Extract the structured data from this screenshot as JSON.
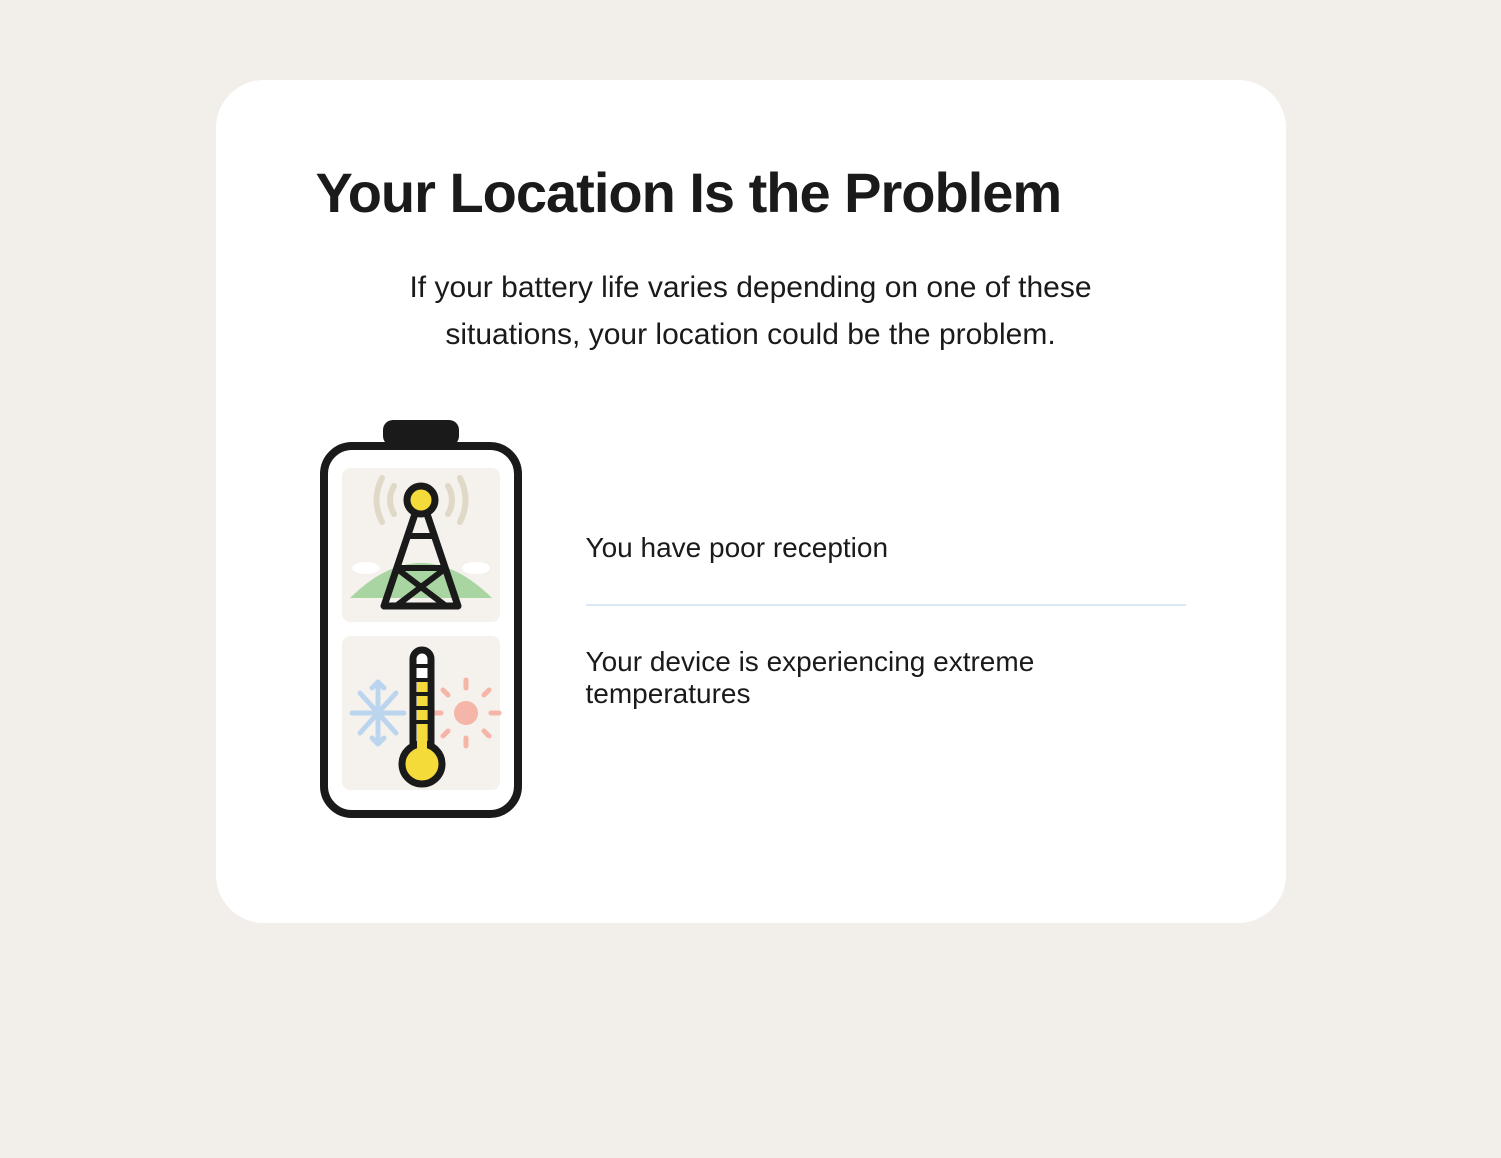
{
  "title": "Your Location Is the Problem",
  "subtitle": "If your battery life varies depending on one of these situations, your location could be the problem.",
  "items": [
    "You have poor reception",
    "Your device is experiencing extreme temperatures"
  ]
}
